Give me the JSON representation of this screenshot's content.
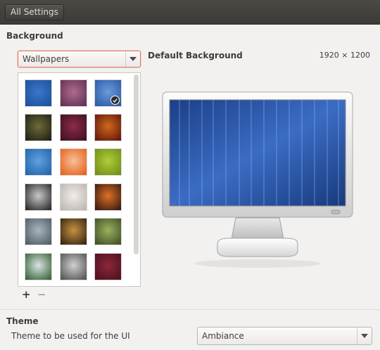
{
  "titlebar": {
    "all_settings_label": "All Settings"
  },
  "background": {
    "heading": "Background",
    "source_select": {
      "value": "Wallpapers"
    },
    "preview_title": "Default Background",
    "resolution": "1920 × 1200",
    "add_label": "+",
    "remove_label": "−",
    "selected_index": 2,
    "wallpapers": [
      {
        "name": "wallpaper-blue-stripes-thumb",
        "c1": "#1b4f9a",
        "c2": "#3a76c8"
      },
      {
        "name": "wallpaper-purple-flare-thumb",
        "c1": "#5a2d4e",
        "c2": "#b06a8e"
      },
      {
        "name": "wallpaper-blue-default-thumb",
        "c1": "#2456a6",
        "c2": "#6c9ad8"
      },
      {
        "name": "wallpaper-dark-landscape-thumb",
        "c1": "#1a1d12",
        "c2": "#6e6a3a"
      },
      {
        "name": "wallpaper-dark-rose-thumb",
        "c1": "#3a0f1e",
        "c2": "#8a2c48"
      },
      {
        "name": "wallpaper-red-leaves-thumb",
        "c1": "#5a1208",
        "c2": "#d0681c"
      },
      {
        "name": "wallpaper-blue-sky-thumb",
        "c1": "#1f5fa8",
        "c2": "#5fa2e0"
      },
      {
        "name": "wallpaper-orange-stripes-thumb",
        "c1": "#e65a10",
        "c2": "#f6c09a"
      },
      {
        "name": "wallpaper-green-drops-thumb",
        "c1": "#6a8a12",
        "c2": "#b2cc3c"
      },
      {
        "name": "wallpaper-bw-tree-thumb",
        "c1": "#1e1e1e",
        "c2": "#c8c8c8"
      },
      {
        "name": "wallpaper-dot-pattern-thumb",
        "c1": "#b8b2ac",
        "c2": "#f0ece8"
      },
      {
        "name": "wallpaper-sunset-thumb",
        "c1": "#2a1410",
        "c2": "#e07024"
      },
      {
        "name": "wallpaper-misty-sky-thumb",
        "c1": "#4a5660",
        "c2": "#a8b6be"
      },
      {
        "name": "wallpaper-dandelion-thumb",
        "c1": "#2a1e10",
        "c2": "#c89040"
      },
      {
        "name": "wallpaper-green-leaf-thumb",
        "c1": "#3a4a20",
        "c2": "#9ab060"
      },
      {
        "name": "wallpaper-green-plant-thumb",
        "c1": "#2e5a2e",
        "c2": "#d8e4e0"
      },
      {
        "name": "wallpaper-grey-abstract-thumb",
        "c1": "#4a4a4a",
        "c2": "#d0d0d0"
      },
      {
        "name": "wallpaper-maroon-bokeh-thumb",
        "c1": "#4a0e1e",
        "c2": "#8a2838"
      }
    ]
  },
  "theme": {
    "heading": "Theme",
    "description": "Theme to be used for the UI",
    "select": {
      "value": "Ambiance"
    }
  },
  "colors": {
    "accent_focus": "#e07a5f",
    "titlebar": "#3c3b37"
  }
}
